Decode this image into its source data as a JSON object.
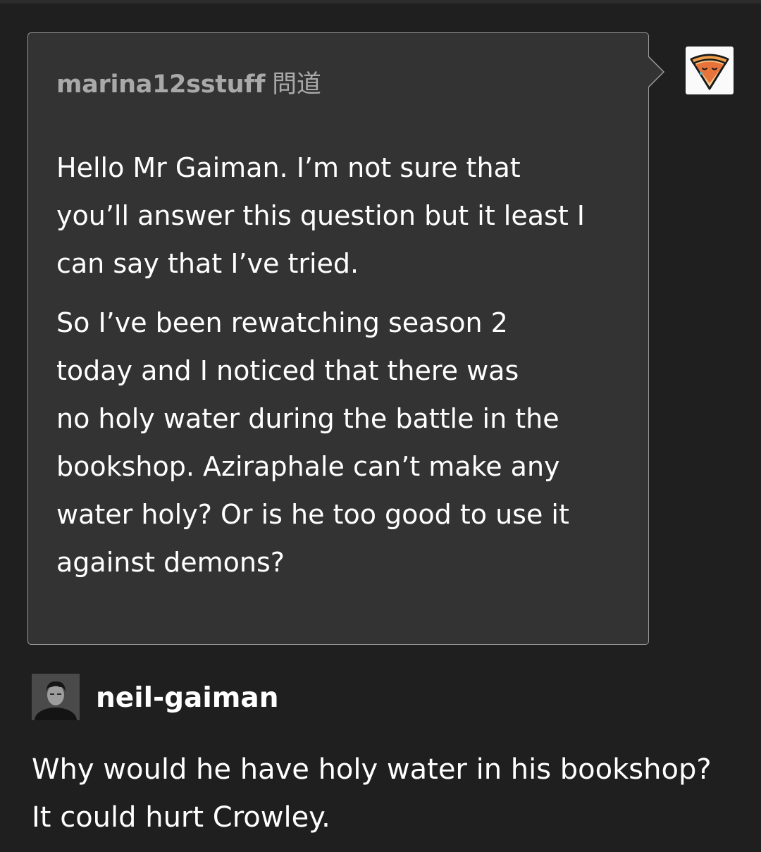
{
  "ask": {
    "asker": "marina12sstuff",
    "asked_label": "問道",
    "question_paragraphs": [
      [
        "Hello Mr Gaiman. I’m not sure that",
        "you’ll answer this question but it least I",
        "can say that I’ve tried."
      ],
      [
        "So I’ve been rewatching season 2",
        "today and I noticed that there was",
        "no holy water during the battle in the",
        "bookshop. Aziraphale can’t make any",
        "water holy? Or is he too good to use it",
        "against demons?"
      ]
    ],
    "avatar_icon": "pizza-slice-icon"
  },
  "answer": {
    "answerer": "neil-gaiman",
    "avatar_icon": "profile-photo",
    "text_lines": [
      "Why would he have holy water in his bookshop?",
      "It could hurt Crowley."
    ]
  },
  "colors": {
    "background": "#1f1f1f",
    "ask_background": "#333333",
    "ask_border": "#9a9a9a",
    "asker_text": "#a9a9a9",
    "text": "#ffffff",
    "pizza_crust": "#f0a04a",
    "pizza_sauce": "#e8743b"
  }
}
